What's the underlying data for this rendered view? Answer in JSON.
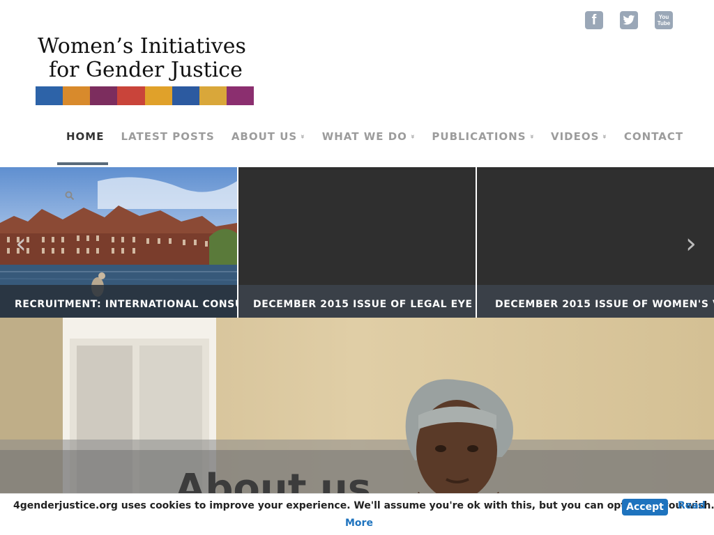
{
  "header": {
    "logo": {
      "line1": "Women’s Initiatives",
      "line2": "for Gender Justice",
      "strip_colors": [
        "#2d63a8",
        "#d88a2c",
        "#7c2d5e",
        "#c9443a",
        "#e0a12a",
        "#2c5aa0",
        "#d9a73a",
        "#8b2f6f"
      ]
    },
    "social": {
      "facebook_glyph": "f",
      "twitter_glyph": "t",
      "youtube_top": "You",
      "youtube_bottom": "Tube",
      "color": "#9aa7b7"
    },
    "nav": [
      {
        "label": "HOME",
        "active": true
      },
      {
        "label": "LATEST POSTS"
      },
      {
        "label": "ABOUT US",
        "has_dropdown": true
      },
      {
        "label": "WHAT WE DO",
        "has_dropdown": true
      },
      {
        "label": "PUBLICATIONS",
        "has_dropdown": true
      },
      {
        "label": "VIDEOS",
        "has_dropdown": true
      },
      {
        "label": "CONTACT"
      }
    ],
    "chevron_glyph": "»"
  },
  "slider": {
    "slides": [
      {
        "caption": "RECRUITMENT: INTERNATIONAL CONSU..."
      },
      {
        "caption": "DECEMBER 2015 ISSUE OF LEGAL EYE O..."
      },
      {
        "caption": "DECEMBER 2015 ISSUE OF WOMEN'S V..."
      }
    ],
    "prev_glyph": "‹",
    "next_glyph": "›"
  },
  "hero": {
    "title": "About us"
  },
  "cookie": {
    "text": "4genderjustice.org uses cookies to improve your experience. We'll assume you're ok with this, but you can opt-out if you wish.",
    "accept_label": "Accept",
    "read_more_line1": "Read",
    "read_more_line2": "More"
  }
}
